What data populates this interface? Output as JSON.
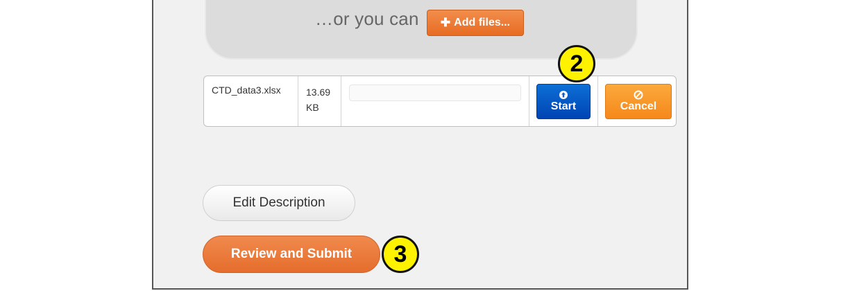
{
  "dropzone": {
    "prompt_text": "…or you can",
    "add_files_label": "Add files..."
  },
  "file": {
    "name": "CTD_data3.xlsx",
    "size_value": "13.69",
    "size_unit": "KB",
    "progress": 0,
    "start_label": "Start",
    "cancel_label": "Cancel"
  },
  "actions": {
    "edit_description_label": "Edit Description",
    "review_submit_label": "Review and Submit"
  },
  "callouts": {
    "step2": "2",
    "step3": "3"
  },
  "colors": {
    "start_button": "#0052c2",
    "cancel_button": "#f7931e",
    "accent_orange": "#e8732e",
    "callout_yellow": "#fff200"
  }
}
